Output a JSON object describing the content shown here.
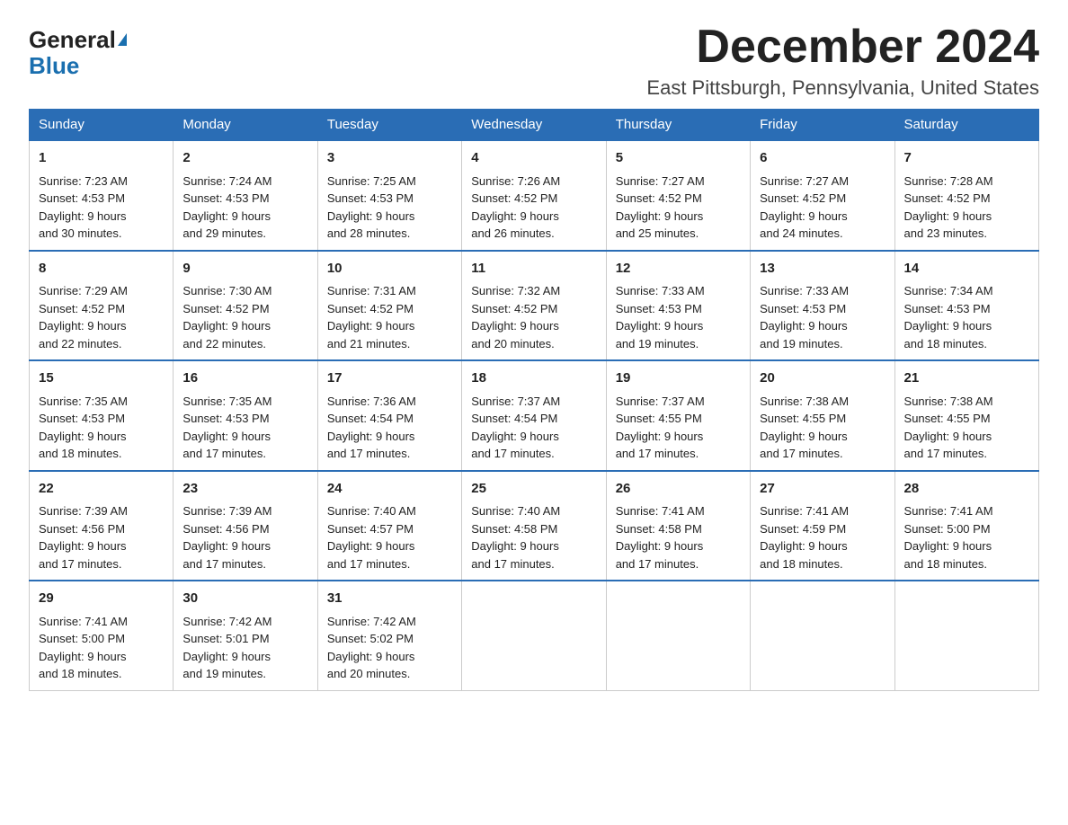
{
  "logo": {
    "text_general": "General",
    "text_blue": "Blue"
  },
  "title": "December 2024",
  "location": "East Pittsburgh, Pennsylvania, United States",
  "days_of_week": [
    "Sunday",
    "Monday",
    "Tuesday",
    "Wednesday",
    "Thursday",
    "Friday",
    "Saturday"
  ],
  "weeks": [
    [
      {
        "day": "1",
        "sunrise": "7:23 AM",
        "sunset": "4:53 PM",
        "daylight": "9 hours and 30 minutes."
      },
      {
        "day": "2",
        "sunrise": "7:24 AM",
        "sunset": "4:53 PM",
        "daylight": "9 hours and 29 minutes."
      },
      {
        "day": "3",
        "sunrise": "7:25 AM",
        "sunset": "4:53 PM",
        "daylight": "9 hours and 28 minutes."
      },
      {
        "day": "4",
        "sunrise": "7:26 AM",
        "sunset": "4:52 PM",
        "daylight": "9 hours and 26 minutes."
      },
      {
        "day": "5",
        "sunrise": "7:27 AM",
        "sunset": "4:52 PM",
        "daylight": "9 hours and 25 minutes."
      },
      {
        "day": "6",
        "sunrise": "7:27 AM",
        "sunset": "4:52 PM",
        "daylight": "9 hours and 24 minutes."
      },
      {
        "day": "7",
        "sunrise": "7:28 AM",
        "sunset": "4:52 PM",
        "daylight": "9 hours and 23 minutes."
      }
    ],
    [
      {
        "day": "8",
        "sunrise": "7:29 AM",
        "sunset": "4:52 PM",
        "daylight": "9 hours and 22 minutes."
      },
      {
        "day": "9",
        "sunrise": "7:30 AM",
        "sunset": "4:52 PM",
        "daylight": "9 hours and 22 minutes."
      },
      {
        "day": "10",
        "sunrise": "7:31 AM",
        "sunset": "4:52 PM",
        "daylight": "9 hours and 21 minutes."
      },
      {
        "day": "11",
        "sunrise": "7:32 AM",
        "sunset": "4:52 PM",
        "daylight": "9 hours and 20 minutes."
      },
      {
        "day": "12",
        "sunrise": "7:33 AM",
        "sunset": "4:53 PM",
        "daylight": "9 hours and 19 minutes."
      },
      {
        "day": "13",
        "sunrise": "7:33 AM",
        "sunset": "4:53 PM",
        "daylight": "9 hours and 19 minutes."
      },
      {
        "day": "14",
        "sunrise": "7:34 AM",
        "sunset": "4:53 PM",
        "daylight": "9 hours and 18 minutes."
      }
    ],
    [
      {
        "day": "15",
        "sunrise": "7:35 AM",
        "sunset": "4:53 PM",
        "daylight": "9 hours and 18 minutes."
      },
      {
        "day": "16",
        "sunrise": "7:35 AM",
        "sunset": "4:53 PM",
        "daylight": "9 hours and 17 minutes."
      },
      {
        "day": "17",
        "sunrise": "7:36 AM",
        "sunset": "4:54 PM",
        "daylight": "9 hours and 17 minutes."
      },
      {
        "day": "18",
        "sunrise": "7:37 AM",
        "sunset": "4:54 PM",
        "daylight": "9 hours and 17 minutes."
      },
      {
        "day": "19",
        "sunrise": "7:37 AM",
        "sunset": "4:55 PM",
        "daylight": "9 hours and 17 minutes."
      },
      {
        "day": "20",
        "sunrise": "7:38 AM",
        "sunset": "4:55 PM",
        "daylight": "9 hours and 17 minutes."
      },
      {
        "day": "21",
        "sunrise": "7:38 AM",
        "sunset": "4:55 PM",
        "daylight": "9 hours and 17 minutes."
      }
    ],
    [
      {
        "day": "22",
        "sunrise": "7:39 AM",
        "sunset": "4:56 PM",
        "daylight": "9 hours and 17 minutes."
      },
      {
        "day": "23",
        "sunrise": "7:39 AM",
        "sunset": "4:56 PM",
        "daylight": "9 hours and 17 minutes."
      },
      {
        "day": "24",
        "sunrise": "7:40 AM",
        "sunset": "4:57 PM",
        "daylight": "9 hours and 17 minutes."
      },
      {
        "day": "25",
        "sunrise": "7:40 AM",
        "sunset": "4:58 PM",
        "daylight": "9 hours and 17 minutes."
      },
      {
        "day": "26",
        "sunrise": "7:41 AM",
        "sunset": "4:58 PM",
        "daylight": "9 hours and 17 minutes."
      },
      {
        "day": "27",
        "sunrise": "7:41 AM",
        "sunset": "4:59 PM",
        "daylight": "9 hours and 18 minutes."
      },
      {
        "day": "28",
        "sunrise": "7:41 AM",
        "sunset": "5:00 PM",
        "daylight": "9 hours and 18 minutes."
      }
    ],
    [
      {
        "day": "29",
        "sunrise": "7:41 AM",
        "sunset": "5:00 PM",
        "daylight": "9 hours and 18 minutes."
      },
      {
        "day": "30",
        "sunrise": "7:42 AM",
        "sunset": "5:01 PM",
        "daylight": "9 hours and 19 minutes."
      },
      {
        "day": "31",
        "sunrise": "7:42 AM",
        "sunset": "5:02 PM",
        "daylight": "9 hours and 20 minutes."
      },
      null,
      null,
      null,
      null
    ]
  ],
  "labels": {
    "sunrise": "Sunrise:",
    "sunset": "Sunset:",
    "daylight": "Daylight:"
  }
}
